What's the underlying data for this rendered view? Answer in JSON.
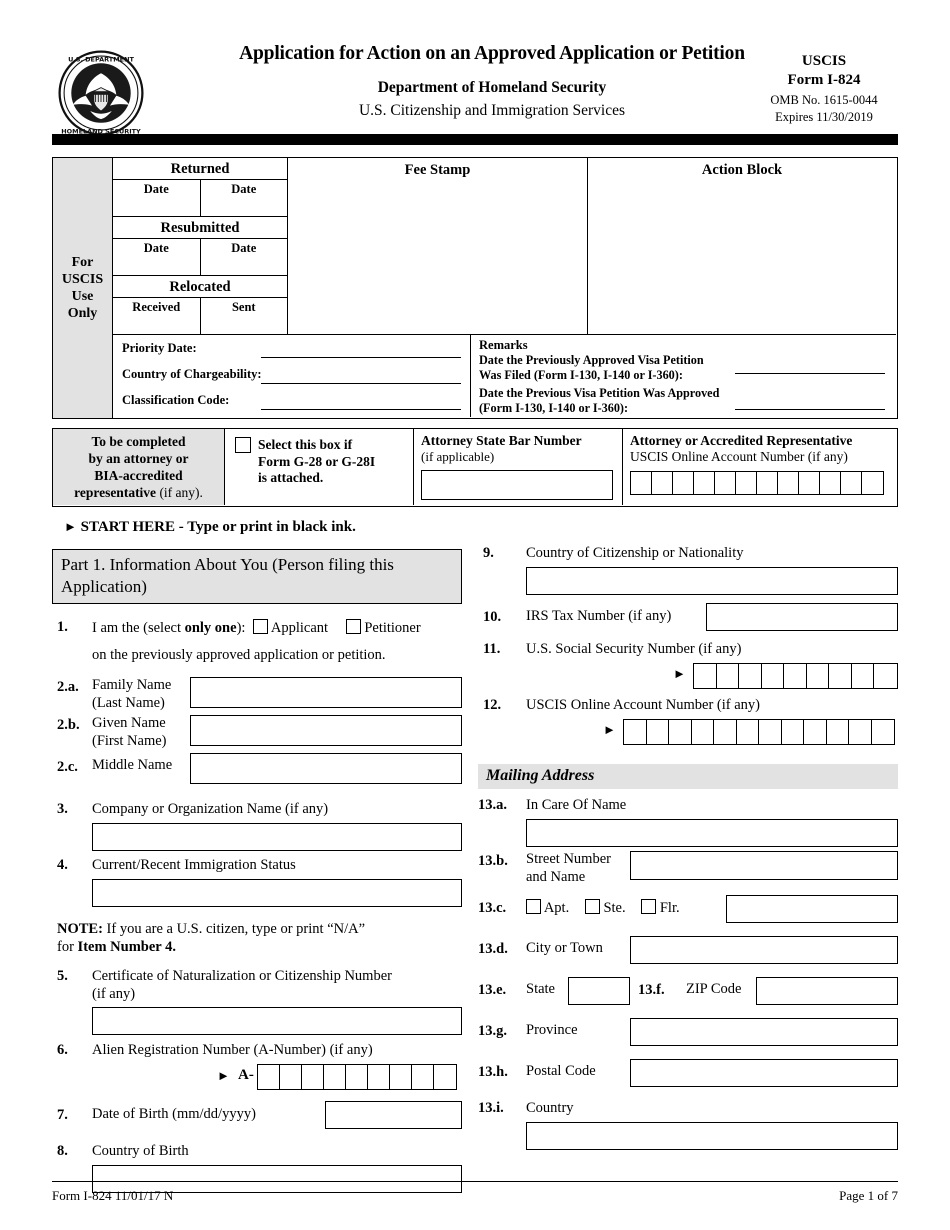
{
  "header": {
    "title": "Application for Action on an Approved Application or Petition",
    "department": "Department of Homeland Security",
    "agency": "U.S. Citizenship and Immigration Services",
    "uscis": "USCIS",
    "form_no": "Form I-824",
    "omb": "OMB No. 1615-0044",
    "expires": "Expires 11/30/2019",
    "seal_alt": "dhs-seal"
  },
  "uscis_block": {
    "left_label": "For\nUSCIS\nUse\nOnly",
    "left_label_lines": [
      "For",
      "USCIS",
      "Use",
      "Only"
    ],
    "returned": {
      "heading": "Returned",
      "cell1": "Date",
      "cell2": "Date"
    },
    "resubmitted": {
      "heading": "Resubmitted",
      "cell1": "Date",
      "cell2": "Date"
    },
    "relocated": {
      "heading": "Relocated",
      "cell1": "Received",
      "cell2": "Sent"
    },
    "fee_stamp": "Fee Stamp",
    "action_block": "Action Block",
    "priority_date": "Priority Date:",
    "country_of_chargeability": "Country of Chargeability:",
    "classification_code": "Classification Code:",
    "remarks": "Remarks",
    "remark_1_line1": "Date the Previously Approved Visa Petition",
    "remark_1_line2": "Was Filed (Form I-130, I-140 or I-360):",
    "remark_2_line1": "Date the Previous Visa Petition Was Approved",
    "remark_2_line2": "(Form I-130, I-140 or I-360):"
  },
  "attorney": {
    "to_be_completed_lines": [
      "To be completed",
      "by an attorney or",
      "BIA-accredited",
      "representative (if any)."
    ],
    "to_be_completed_l4_bold": "representative",
    "to_be_completed_l4_rest": " (if any).",
    "g28_checkbox_label_lines": [
      "Select this box if",
      "Form G-28 or G-28I",
      "is attached."
    ],
    "state_bar_heading": "Attorney State Bar Number",
    "state_bar_sub": "(if applicable)",
    "online_acct_line1": "Attorney or Accredited Representative",
    "online_acct_line2_bold": "USCIS Online Account Number",
    "online_acct_line2_rest": " (if any)",
    "online_acct_cells": 12
  },
  "start_here": "START HERE - Type or print in black ink.",
  "part1": {
    "heading_bold": "Part 1.  Information About You",
    "heading_rest": " (Person filing this Application)",
    "item1": {
      "num": "1.",
      "prefix": "I am the (select ",
      "bold": "only one",
      "suffix": "):",
      "option1": "Applicant",
      "option2": "Petitioner",
      "line2": "on the previously approved application or petition."
    },
    "item2a": {
      "num": "2.a.",
      "line1": "Family Name",
      "line2": "(Last Name)"
    },
    "item2b": {
      "num": "2.b.",
      "line1": "Given Name",
      "line2": "(First Name)"
    },
    "item2c": {
      "num": "2.c.",
      "line1": "Middle Name"
    },
    "item3": {
      "num": "3.",
      "label": "Company or Organization Name (if any)"
    },
    "item4": {
      "num": "4.",
      "label": "Current/Recent Immigration Status"
    },
    "note": {
      "bold": "NOTE:",
      "text": "  If you are a U.S. citizen, type or print “N/A”",
      "line2_pre": "for ",
      "line2_bold": "Item Number 4."
    },
    "item5": {
      "num": "5.",
      "line1": "Certificate of Naturalization or Citizenship Number",
      "line2": "(if any)"
    },
    "item6": {
      "num": "6.",
      "label": "Alien Registration Number (A-Number) (if any)",
      "prefix": "A-",
      "cells": 9
    },
    "item7": {
      "num": "7.",
      "label": "Date of Birth (mm/dd/yyyy)"
    },
    "item8": {
      "num": "8.",
      "label": "Country of Birth"
    },
    "item9": {
      "num": "9.",
      "label": "Country of Citizenship or Nationality"
    },
    "item10": {
      "num": "10.",
      "label": "IRS Tax Number (if any)"
    },
    "item11": {
      "num": "11.",
      "label": "U.S. Social Security Number (if any)",
      "cells": 9
    },
    "item12": {
      "num": "12.",
      "label": "USCIS Online Account Number (if any)",
      "cells": 12
    }
  },
  "mailing_address": {
    "heading": "Mailing Address",
    "item13a": {
      "num": "13.a.",
      "label": "In Care Of Name"
    },
    "item13b": {
      "num": "13.b.",
      "line1": "Street Number",
      "line2": "and Name"
    },
    "item13c": {
      "num": "13.c.",
      "opt1": "Apt.",
      "opt2": "Ste.",
      "opt3": "Flr."
    },
    "item13d": {
      "num": "13.d.",
      "label": "City or Town"
    },
    "item13e": {
      "num": "13.e.",
      "label": "State"
    },
    "item13f": {
      "num": "13.f.",
      "label": "ZIP Code"
    },
    "item13g": {
      "num": "13.g.",
      "label": "Province"
    },
    "item13h": {
      "num": "13.h.",
      "label": "Postal Code"
    },
    "item13i": {
      "num": "13.i.",
      "label": "Country"
    }
  },
  "footer": {
    "left": "Form I-824  11/01/17  N",
    "right": "Page 1 of 7"
  },
  "colors": {
    "shade": "#e2e2e2",
    "rule": "#000000"
  }
}
